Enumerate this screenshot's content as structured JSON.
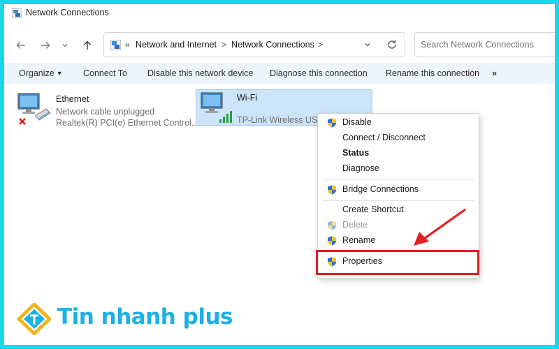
{
  "window": {
    "title": "Network Connections"
  },
  "nav": {
    "back_icon": "arrow-left-icon",
    "forward_icon": "arrow-right-icon",
    "recent_icon": "chevron-down-icon",
    "up_icon": "arrow-up-icon"
  },
  "address": {
    "overflow": "«",
    "crumbs": [
      "Network and Internet",
      "Network Connections"
    ],
    "separator": ">"
  },
  "search": {
    "placeholder": "Search Network Connections"
  },
  "commands": {
    "organize": "Organize",
    "connect_to": "Connect To",
    "disable": "Disable this network device",
    "diagnose": "Diagnose this connection",
    "rename": "Rename this connection",
    "more": "»"
  },
  "adapters": [
    {
      "name": "Ethernet",
      "status": "Network cable unplugged",
      "device": "Realtek(R) PCI(e) Ethernet Control..."
    },
    {
      "name": "Wi-Fi",
      "status": "",
      "device": "TP-Link Wireless USB A"
    }
  ],
  "context_menu": {
    "items": [
      {
        "label": "Disable",
        "shield": true,
        "bold": false,
        "disabled": false
      },
      {
        "label": "Connect / Disconnect",
        "shield": false,
        "bold": false,
        "disabled": false
      },
      {
        "label": "Status",
        "shield": false,
        "bold": true,
        "disabled": false
      },
      {
        "label": "Diagnose",
        "shield": false,
        "bold": false,
        "disabled": false
      },
      {
        "label": "Bridge Connections",
        "shield": true,
        "bold": false,
        "disabled": false
      },
      {
        "label": "Create Shortcut",
        "shield": false,
        "bold": false,
        "disabled": false
      },
      {
        "label": "Delete",
        "shield": true,
        "bold": false,
        "disabled": true
      },
      {
        "label": "Rename",
        "shield": true,
        "bold": false,
        "disabled": false
      },
      {
        "label": "Properties",
        "shield": true,
        "bold": false,
        "disabled": false
      }
    ]
  },
  "brand": {
    "name": "Tin nhanh plus"
  },
  "colors": {
    "frame": "#19d6ea",
    "highlight": "#e31e24",
    "selection": "#cce4f7",
    "brand": "#1ab0e8"
  }
}
